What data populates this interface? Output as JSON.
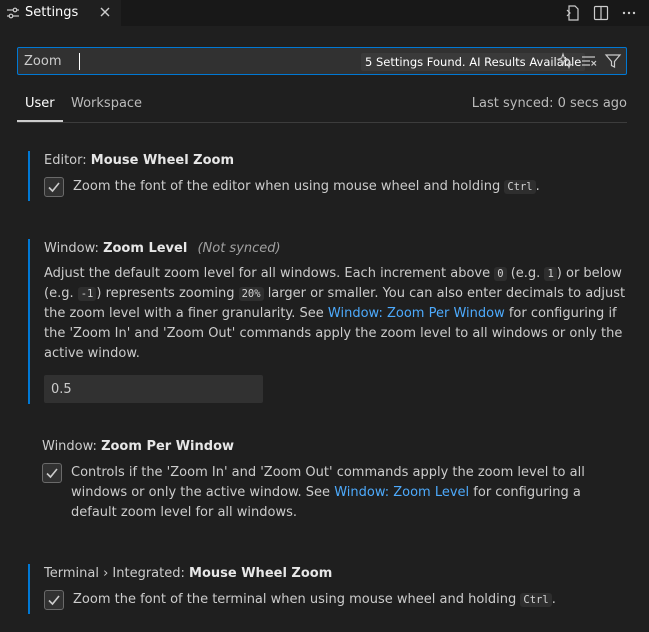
{
  "tab": {
    "title": "Settings"
  },
  "search": {
    "value": "Zoom",
    "results": "5 Settings Found. AI Results Available"
  },
  "scope": {
    "user": "User",
    "workspace": "Workspace",
    "last_synced": "Last synced: 0 secs ago"
  },
  "settings": [
    {
      "category": "Editor:",
      "name": "Mouse Wheel Zoom",
      "checked": true,
      "desc_pre": "Zoom the font of the editor when using mouse wheel and holding ",
      "desc_code": "Ctrl",
      "desc_post": "."
    },
    {
      "category": "Window:",
      "name": "Zoom Level",
      "not_synced": "(Not synced)",
      "line1_a": "Adjust the default zoom level for all windows. Each increment above ",
      "code0": "0",
      "line1_b": " (e.g. ",
      "code1": "1",
      "line1_c": ") or below",
      "line2_a": "(e.g. ",
      "code_neg1": "-1",
      "line2_b": ") represents zooming ",
      "code20": "20%",
      "line2_c": " larger or smaller. You can also enter decimals to adjust",
      "line3_a": "the zoom level with a finer granularity. See ",
      "link": "Window: Zoom Per Window",
      "line3_b": " for configuring if",
      "line4": "the 'Zoom In' and 'Zoom Out' commands apply the zoom level to all windows or only the",
      "line5": "active window.",
      "value": "0.5"
    },
    {
      "category": "Window:",
      "name": "Zoom Per Window",
      "checked": true,
      "line1": "Controls if the 'Zoom In' and 'Zoom Out' commands apply the zoom level to all",
      "line2_a": "windows or only the active window. See ",
      "link": "Window: Zoom Level",
      "line2_b": " for configuring a",
      "line3": "default zoom level for all windows."
    },
    {
      "category": "Terminal › Integrated:",
      "name": "Mouse Wheel Zoom",
      "checked": true,
      "desc_pre": "Zoom the font of the terminal when using mouse wheel and holding ",
      "desc_code": "Ctrl",
      "desc_post": "."
    }
  ],
  "colors": {
    "accent": "#0078d4",
    "link": "#4daafc",
    "background": "#1f1f1f"
  }
}
